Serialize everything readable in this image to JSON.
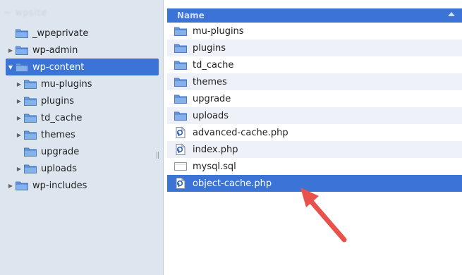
{
  "tree": {
    "root_label": "~ wpsite",
    "items": [
      {
        "label": "_wpeprivate",
        "expander": false,
        "open": false,
        "selected": false,
        "indent": 0
      },
      {
        "label": "wp-admin",
        "expander": true,
        "open": false,
        "selected": false,
        "indent": 0
      },
      {
        "label": "wp-content",
        "expander": true,
        "open": true,
        "selected": true,
        "indent": 0
      },
      {
        "label": "mu-plugins",
        "expander": true,
        "open": false,
        "selected": false,
        "indent": 1
      },
      {
        "label": "plugins",
        "expander": true,
        "open": false,
        "selected": false,
        "indent": 1
      },
      {
        "label": "td_cache",
        "expander": true,
        "open": false,
        "selected": false,
        "indent": 1
      },
      {
        "label": "themes",
        "expander": true,
        "open": false,
        "selected": false,
        "indent": 1
      },
      {
        "label": "upgrade",
        "expander": false,
        "open": false,
        "selected": false,
        "indent": 1
      },
      {
        "label": "uploads",
        "expander": true,
        "open": false,
        "selected": false,
        "indent": 1
      },
      {
        "label": "wp-includes",
        "expander": true,
        "open": false,
        "selected": false,
        "indent": 0
      }
    ]
  },
  "list": {
    "header": "Name",
    "rows": [
      {
        "label": "mu-plugins",
        "icon": "folder-icon",
        "selected": false
      },
      {
        "label": "plugins",
        "icon": "folder-icon",
        "selected": false
      },
      {
        "label": "td_cache",
        "icon": "folder-icon",
        "selected": false
      },
      {
        "label": "themes",
        "icon": "folder-icon",
        "selected": false
      },
      {
        "label": "upgrade",
        "icon": "folder-icon",
        "selected": false
      },
      {
        "label": "uploads",
        "icon": "folder-icon",
        "selected": false
      },
      {
        "label": "advanced-cache.php",
        "icon": "php-file-icon",
        "selected": false
      },
      {
        "label": "index.php",
        "icon": "php-file-icon",
        "selected": false
      },
      {
        "label": "mysql.sql",
        "icon": "sql-file-icon",
        "selected": false
      },
      {
        "label": "object-cache.php",
        "icon": "php-file-icon",
        "selected": true
      }
    ]
  },
  "colors": {
    "selection": "#3b73d6",
    "tree_bg": "#dde6ef",
    "arrow": "#e8524a",
    "folder": "#6a9be0"
  }
}
